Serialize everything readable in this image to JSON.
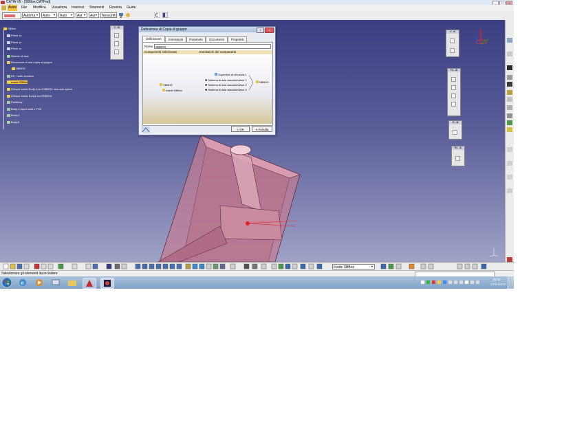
{
  "window": {
    "title": "CATIA V5 - [SBBox.CATPart]"
  },
  "menu": {
    "items": [
      "Avvio",
      "File",
      "Modifica",
      "Visualizza",
      "Inserisci",
      "Strumenti",
      "Finestra",
      "Guida"
    ]
  },
  "toolbar": {
    "combos": [
      {
        "value": "Automa"
      },
      {
        "value": "Auto"
      },
      {
        "value": "Auto"
      },
      {
        "value": "Aut"
      },
      {
        "value": "Aut"
      },
      {
        "value": "Nessuno"
      }
    ]
  },
  "tree": {
    "items": [
      {
        "label": "SBBox"
      },
      {
        "label": "Plane xy"
      },
      {
        "label": "Plane yz"
      },
      {
        "label": "Plane zx"
      },
      {
        "label": "Sistemi di assi"
      },
      {
        "label": "Ricorrenze di una copia di gruppo"
      },
      {
        "label": "SBBOX"
      },
      {
        "label": "Rif + solid creation"
      },
      {
        "label": "Inside SBBox"
      },
      {
        "label": "Z0input solids Body 4,shd SBBOX new axis sytem"
      },
      {
        "label": "Z0input solids Body6 incZSBBOX"
      },
      {
        "label": "PartBody"
      },
      {
        "label": "Body-2,Input solid z PHC"
      },
      {
        "label": "Body.4"
      },
      {
        "label": "Body.5"
      }
    ]
  },
  "floating_toolbars": [
    {
      "title": "E...⊠"
    },
    {
      "title": "V...⊠"
    },
    {
      "title": "Pa...⊠"
    },
    {
      "title": "M...⊠"
    },
    {
      "title": "Sh...⊠"
    }
  ],
  "dialog": {
    "title": "Definizione di Copia di gruppo",
    "tabs": [
      "Definizione",
      "Immissioni",
      "Parametri",
      "Documenti",
      "Proprietà"
    ],
    "name_label": "Nome:",
    "name_value": "SBBOX",
    "col_left": "Componenti selezionati",
    "col_right": "Immissioni dei componenti",
    "left_items": [
      "SBBOX",
      "Inside SBBox"
    ],
    "right_items": [
      "Superficie di chiusura.1",
      "Sistema di assi assoluto\\Asse Y",
      "Sistema di assi assoluto\\Asse Z",
      "Sistema di assi assoluto\\Asse X"
    ],
    "right_target": "SBBOX",
    "ok_label": "OK",
    "cancel_label": "Annulla"
  },
  "bottom_toolbar": {
    "combo_value": "Inside SBBox"
  },
  "status": {
    "text": "Selezionare gli elementi da includere"
  },
  "taskbar": {
    "time": "15:02",
    "date": "12/11/2013"
  },
  "colors": {
    "viewport_top": "#3b3f82",
    "viewport_bottom": "#9fa2c6",
    "part_fill": "#c27d95",
    "selection": "#f5c244"
  }
}
